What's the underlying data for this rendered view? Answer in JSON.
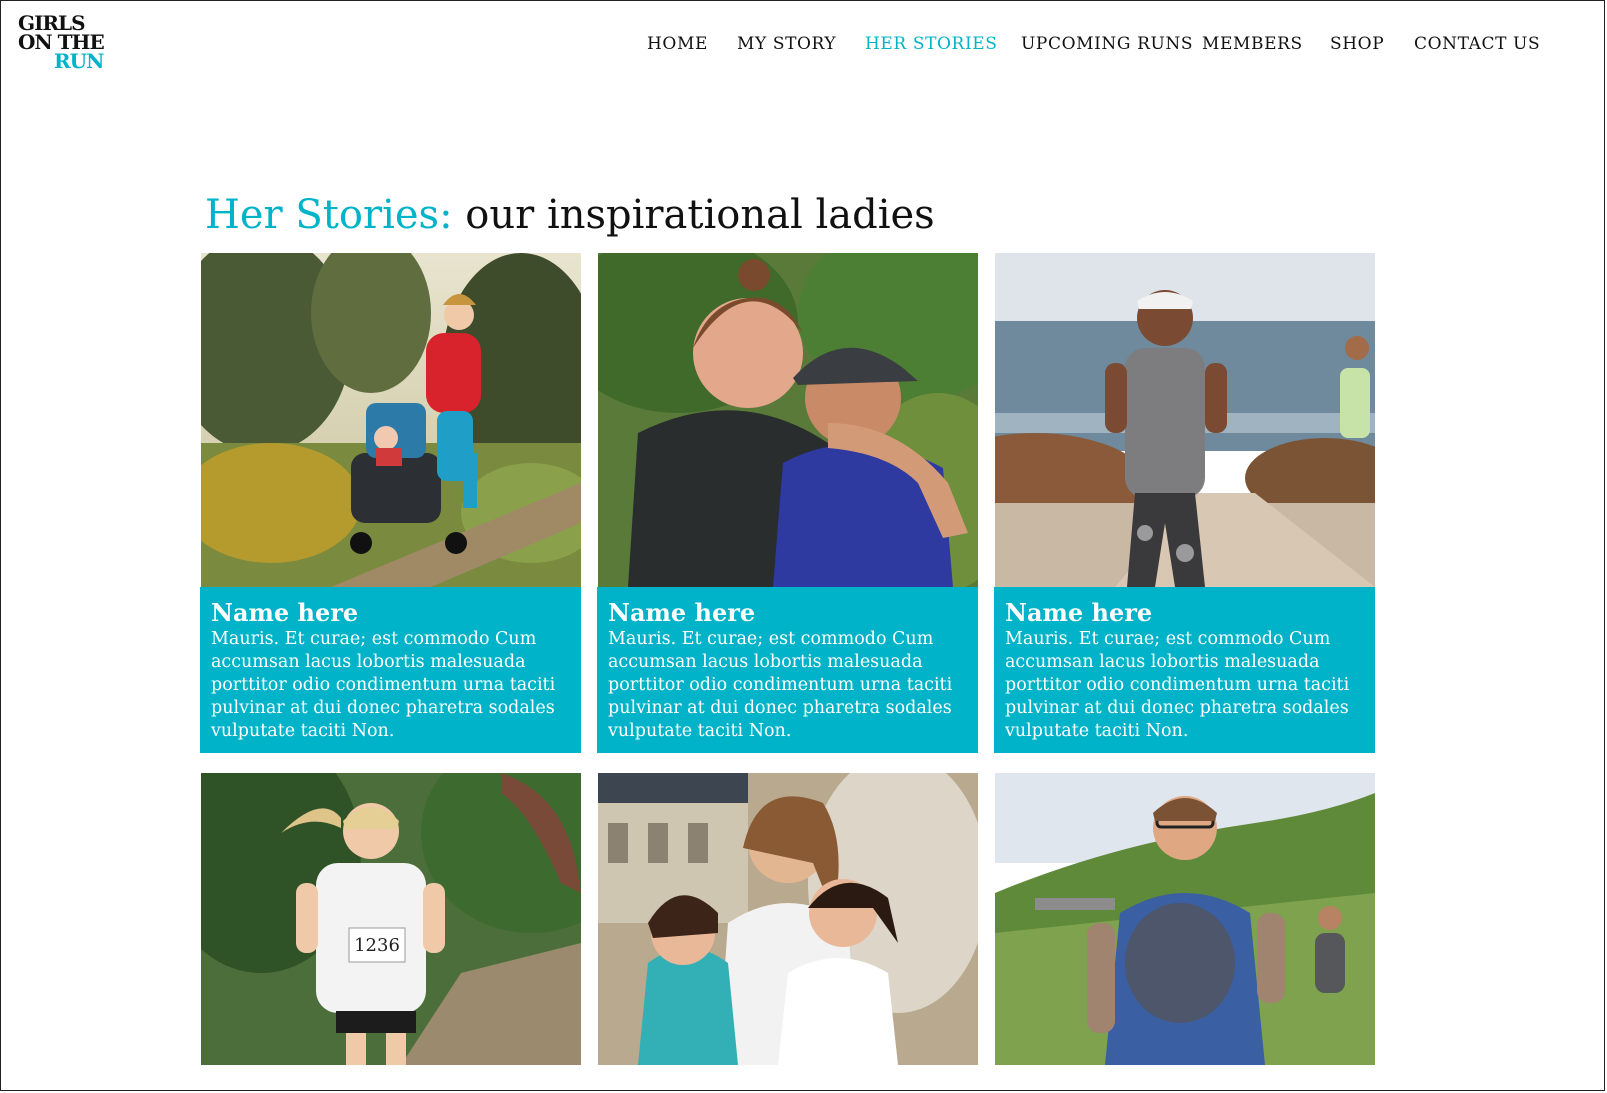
{
  "brand": {
    "logo_line1": "GIRLS",
    "logo_line2": "ON THE",
    "logo_line3": "RUN",
    "accent_color": "#00b3c8"
  },
  "nav": {
    "items": [
      {
        "label": "HOME"
      },
      {
        "label": "MY STORY"
      },
      {
        "label": "HER STORIES",
        "active": true
      },
      {
        "label": "UPCOMING RUNS"
      },
      {
        "label": "MEMBERS"
      },
      {
        "label": "SHOP"
      },
      {
        "label": "CONTACT US"
      }
    ]
  },
  "page": {
    "heading_accent": "Her Stories:",
    "heading_rest": "our inspirational ladies"
  },
  "cards": [
    {
      "name": "Name here",
      "description": "Mauris. Et curae; est commodo Cum accumsan lacus lobortis malesuada porttitor odio condimentum urna taciti pulvinar at dui donec pharetra sodales vulputate taciti Non.",
      "photo": "woman-running-with-stroller-photo"
    },
    {
      "name": "Name here",
      "description": "Mauris. Et curae; est commodo Cum accumsan lacus lobortis malesuada porttitor odio condimentum urna taciti pulvinar at dui donec pharetra sodales vulputate taciti Non.",
      "photo": "two-women-embracing-photo"
    },
    {
      "name": "Name here",
      "description": "Mauris. Et curae; est commodo Cum accumsan lacus lobortis malesuada porttitor odio condimentum urna taciti pulvinar at dui donec pharetra sodales vulputate taciti Non.",
      "photo": "woman-running-by-sea-photo"
    },
    {
      "photo": "race-runner-photo",
      "bib_number": "1236"
    },
    {
      "photo": "mother-and-daughters-photo"
    },
    {
      "photo": "muddy-trail-runner-photo"
    }
  ]
}
